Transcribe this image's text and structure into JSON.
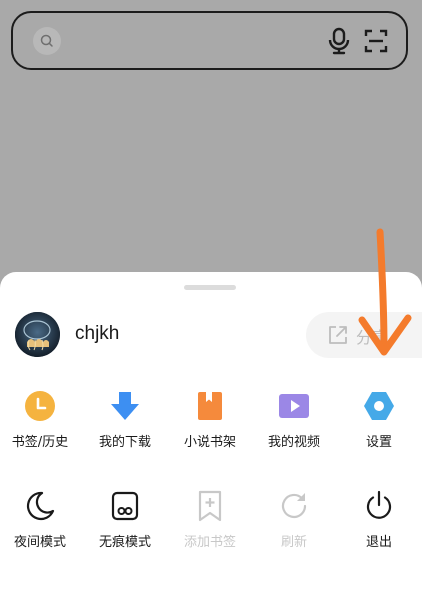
{
  "search": {
    "placeholder": ""
  },
  "profile": {
    "username": "chjkh"
  },
  "share": {
    "label": "分享"
  },
  "menu_row1": [
    {
      "label": "书签/历史",
      "icon": "bookmark-history-icon",
      "color": "#f5b33f"
    },
    {
      "label": "我的下载",
      "icon": "download-icon",
      "color": "#3d8ff2"
    },
    {
      "label": "小说书架",
      "icon": "novel-shelf-icon",
      "color": "#f58a3c"
    },
    {
      "label": "我的视频",
      "icon": "video-icon",
      "color": "#9b87e6"
    },
    {
      "label": "设置",
      "icon": "settings-icon",
      "color": "#45a9e8"
    }
  ],
  "menu_row2": [
    {
      "label": "夜间模式",
      "icon": "night-mode-icon"
    },
    {
      "label": "无痕模式",
      "icon": "incognito-icon"
    },
    {
      "label": "添加书签",
      "icon": "add-bookmark-icon",
      "disabled": true
    },
    {
      "label": "刷新",
      "icon": "refresh-icon",
      "disabled": true
    },
    {
      "label": "退出",
      "icon": "power-icon"
    }
  ],
  "colors": {
    "backdrop": "#a9a9a9",
    "sheet": "#ffffff",
    "annotation_arrow": "#f47b2c"
  }
}
